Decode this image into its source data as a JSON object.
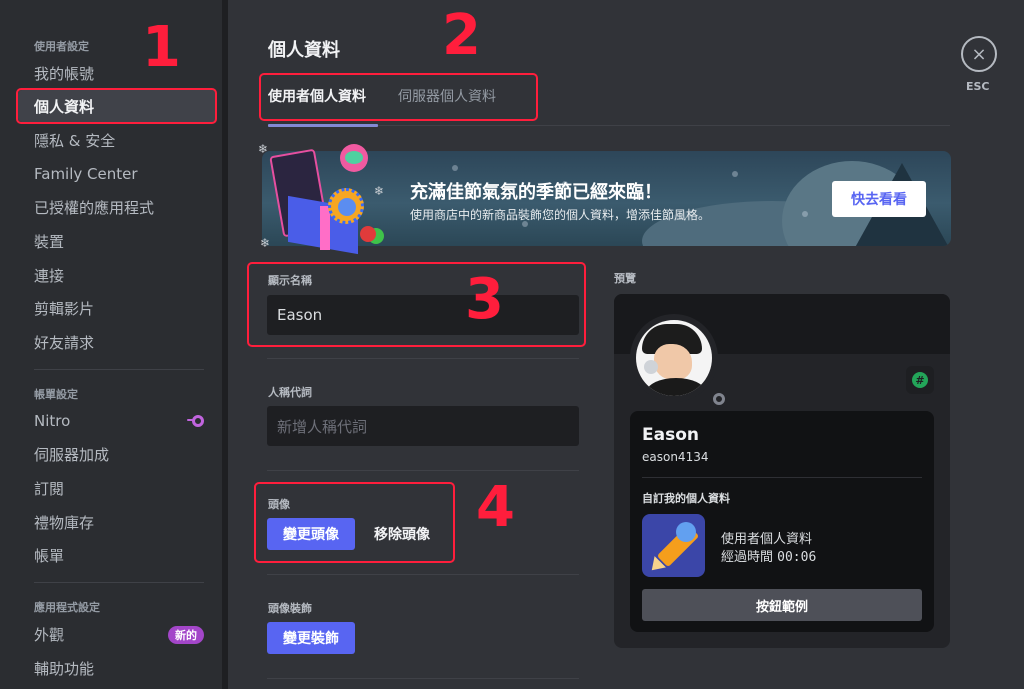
{
  "sidebar": {
    "sections": [
      {
        "header": "使用者設定",
        "items": [
          {
            "label": "我的帳號"
          },
          {
            "label": "個人資料",
            "active": true
          },
          {
            "label": "隱私 & 安全"
          },
          {
            "label": "Family Center"
          },
          {
            "label": "已授權的應用程式"
          },
          {
            "label": "裝置"
          },
          {
            "label": "連接"
          },
          {
            "label": "剪輯影片"
          },
          {
            "label": "好友請求"
          }
        ]
      },
      {
        "header": "帳單設定",
        "items": [
          {
            "label": "Nitro",
            "icon": "nitro-icon"
          },
          {
            "label": "伺服器加成"
          },
          {
            "label": "訂閱"
          },
          {
            "label": "禮物庫存"
          },
          {
            "label": "帳單"
          }
        ]
      },
      {
        "header": "應用程式設定",
        "items": [
          {
            "label": "外觀",
            "badge": "新的"
          },
          {
            "label": "輔助功能"
          }
        ]
      }
    ]
  },
  "main": {
    "title": "個人資料",
    "tabs": [
      {
        "label": "使用者個人資料",
        "active": true
      },
      {
        "label": "伺服器個人資料"
      }
    ],
    "banner": {
      "title": "充滿佳節氣氛的季節已經來臨！",
      "subtitle": "使用商店中的新商品裝飾您的個人資料，增添佳節風格。",
      "button": "快去看看"
    },
    "display_name": {
      "label": "顯示名稱",
      "value": "Eason"
    },
    "pronouns": {
      "label": "人稱代詞",
      "placeholder": "新增人稱代詞"
    },
    "avatar": {
      "label": "頭像",
      "change_button": "變更頭像",
      "remove_button": "移除頭像"
    },
    "avatar_decoration": {
      "label": "頭像裝飾",
      "change_button": "變更裝飾"
    }
  },
  "preview": {
    "label": "預覽",
    "display_name": "Eason",
    "username": "eason4134",
    "badge_icon": "#",
    "section_heading": "自訂我的個人資料",
    "activity": {
      "title": "使用者個人資料",
      "elapsed_label": "經過時間",
      "elapsed": "00:06"
    },
    "example_button": "按鈕範例"
  },
  "close": {
    "label": "ESC",
    "icon": "×"
  },
  "annotations": [
    "1",
    "2",
    "3",
    "4"
  ],
  "colors": {
    "accent": "#5865f2",
    "annotation": "#ff1e3c",
    "nitro": "#c164de",
    "new_badge": "#a346c9",
    "online": "#23a559"
  }
}
